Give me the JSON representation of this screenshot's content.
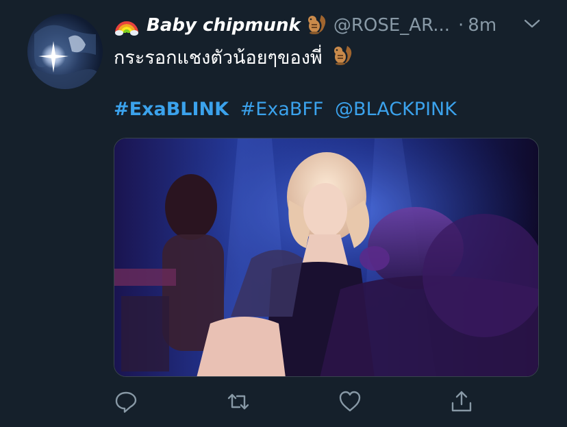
{
  "user": {
    "display_name": "Baby chipmunk",
    "handle": "@ROSE_AR...",
    "separator": "·",
    "time": "8m"
  },
  "tweet": {
    "text": "กระรอกแชงตัวน้อยๆของพี่"
  },
  "hashtags": [
    {
      "text": "#ExaBLINK"
    },
    {
      "text": "#ExaBFF"
    },
    {
      "text": "@BLACKPINK"
    }
  ],
  "icons": {
    "rainbow": "rainbow-icon",
    "chipmunk": "chipmunk-icon",
    "chevron": "chevron-down-icon",
    "reply": "reply-icon",
    "retweet": "retweet-icon",
    "like": "heart-icon",
    "share": "share-icon"
  },
  "colors": {
    "background": "#15202b",
    "link": "#1da1f2",
    "secondary_text": "#8899a6",
    "primary_text": "#ffffff"
  }
}
